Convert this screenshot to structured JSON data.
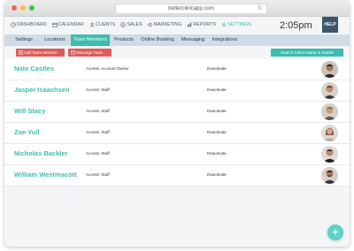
{
  "browser": {
    "url": "betterclinicapp.com"
  },
  "nav": {
    "items": [
      {
        "label": "DASHBOARD",
        "icon": "dashboard-icon",
        "active": false
      },
      {
        "label": "CALENDAR",
        "icon": "calendar-icon",
        "active": false
      },
      {
        "label": "CLIENTS",
        "icon": "clients-icon",
        "active": false
      },
      {
        "label": "SALES",
        "icon": "sales-icon",
        "active": false
      },
      {
        "label": "MARKETING",
        "icon": "marketing-icon",
        "active": false
      },
      {
        "label": "REPORTS",
        "icon": "reports-icon",
        "active": false
      },
      {
        "label": "SETTINGS",
        "icon": "settings-icon",
        "active": true
      }
    ],
    "time": "2:05pm",
    "help": "HELP"
  },
  "subnav": {
    "tabs": [
      {
        "label": "Settings",
        "active": false
      },
      {
        "label": "Locations",
        "active": false
      },
      {
        "label": "Team Members",
        "active": true
      },
      {
        "label": "Products",
        "active": false
      },
      {
        "label": "Online Booking",
        "active": false
      },
      {
        "label": "Messaging",
        "active": false
      },
      {
        "label": "Integrations",
        "active": false
      }
    ]
  },
  "actions": {
    "add_label": "Add Team Member",
    "message_label": "Message Team",
    "search_label": "Search Client Name or Mobile"
  },
  "team": [
    {
      "name": "Nate Castles",
      "access": "Access: Account Owner",
      "action": "Deactivate"
    },
    {
      "name": "Jasper Isaachsen",
      "access": "Access: Staff",
      "action": "Deactivate"
    },
    {
      "name": "Will Stacy",
      "access": "Access: Staff",
      "action": "Deactivate"
    },
    {
      "name": "Zoe Yull",
      "access": "Access: Staff",
      "action": "Deactivate"
    },
    {
      "name": "Nicholas Backler",
      "access": "Access: Staff",
      "action": "Deactivate"
    },
    {
      "name": "William Westmacott",
      "access": "Access: Staff",
      "action": "Deactivate"
    }
  ],
  "fab": "+",
  "colors": {
    "accent": "#3cbdb0",
    "danger": "#e05a5a",
    "header_dark": "#3d5566",
    "subnav_bg": "#cfdbe5"
  }
}
